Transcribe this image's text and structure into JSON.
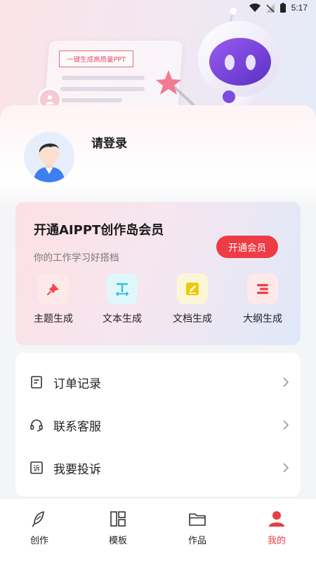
{
  "status_bar": {
    "time": "5:17"
  },
  "hero": {
    "doc_headline": "一键生成高质量PPT"
  },
  "profile": {
    "login_text": "请登录"
  },
  "vip_card": {
    "title": "开通AIPPT创作岛会员",
    "subtitle": "你的工作学习好搭档",
    "button": "开通会员",
    "features": [
      {
        "label": "主题生成",
        "icon": "pin-icon",
        "bg": "#fde8ea",
        "color": "#f04848"
      },
      {
        "label": "文本生成",
        "icon": "text-icon",
        "bg": "#dff7fb",
        "color": "#2cc3d8"
      },
      {
        "label": "文档生成",
        "icon": "edit-icon",
        "bg": "#fbf7d6",
        "color": "#e9c90d"
      },
      {
        "label": "大纲生成",
        "icon": "outline-icon",
        "bg": "#fde8ea",
        "color": "#ef3f46"
      }
    ]
  },
  "menu": {
    "items": [
      {
        "label": "订单记录",
        "icon": "order-icon"
      },
      {
        "label": "联系客服",
        "icon": "headset-icon"
      },
      {
        "label": "我要投诉",
        "icon": "complaint-icon"
      }
    ]
  },
  "tabbar": {
    "items": [
      {
        "label": "创作",
        "icon": "feather-icon"
      },
      {
        "label": "模板",
        "icon": "template-icon"
      },
      {
        "label": "作品",
        "icon": "folder-icon"
      },
      {
        "label": "我的",
        "icon": "person-icon"
      }
    ],
    "active_index": 3,
    "active_color": "#e93c44"
  }
}
